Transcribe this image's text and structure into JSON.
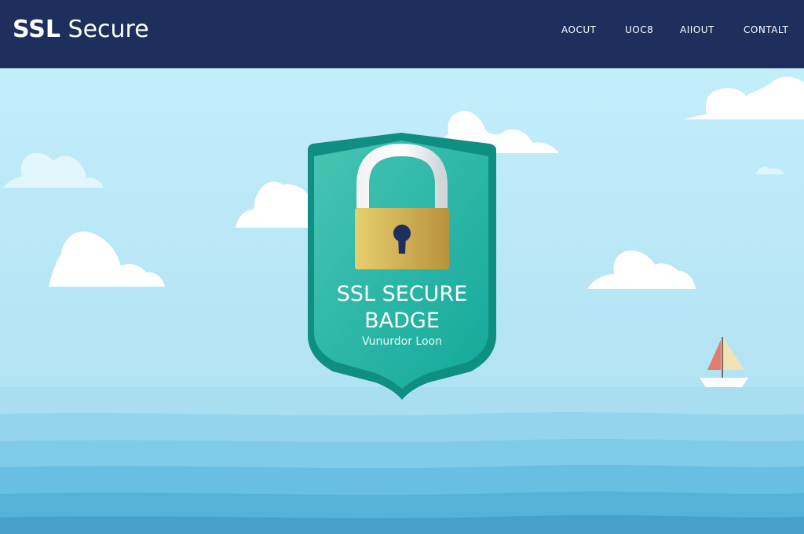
{
  "header": {
    "logo_bold": "SSL",
    "logo_light": " Secure",
    "nav": [
      "AOCUT",
      "UOC8",
      "AIIOUT",
      "CONTALT"
    ]
  },
  "badge": {
    "line1": "SSL SECURE",
    "line2": "BADGE",
    "subtitle": "Vunurdor Loon"
  },
  "colors": {
    "header_bg": "#1e2f5e",
    "shield": "#1fb8a4",
    "lock_body": "#c9a94a",
    "sky": "#c5eef9",
    "sea": "#6fc4e2"
  },
  "icons": [
    "padlock-icon",
    "shield-icon",
    "sailboat-icon",
    "cloud-icon"
  ]
}
